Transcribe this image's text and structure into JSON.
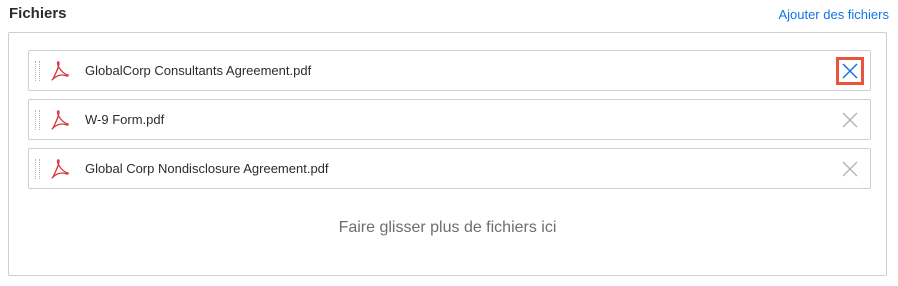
{
  "header": {
    "title": "Fichiers",
    "add_link": "Ajouter des fichiers"
  },
  "files": [
    {
      "name": "GlobalCorp Consultants Agreement.pdf",
      "icon": "pdf-icon",
      "remove_highlighted": true
    },
    {
      "name": "W-9 Form.pdf",
      "icon": "pdf-icon",
      "remove_highlighted": false
    },
    {
      "name": "Global Corp Nondisclosure Agreement.pdf",
      "icon": "pdf-icon",
      "remove_highlighted": false
    }
  ],
  "drop_zone": {
    "hint": "Faire glisser plus de fichiers ici"
  },
  "colors": {
    "link": "#1473e6",
    "pdf_red": "#d7373f",
    "focus_ring": "#e8553f",
    "remove_active": "#1473e6",
    "remove_idle": "#b3b3b3"
  }
}
